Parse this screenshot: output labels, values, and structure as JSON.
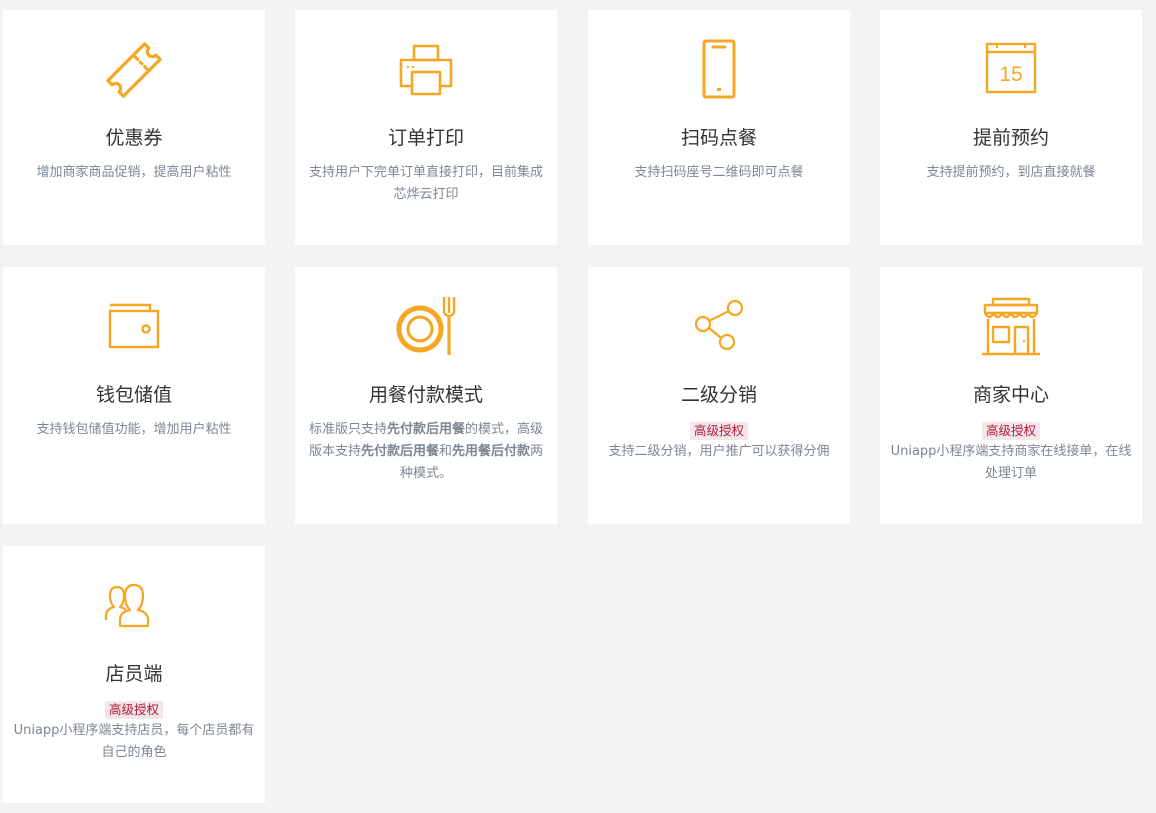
{
  "accent_color": "#f5a623",
  "badge_colors": {
    "background": "#f4e7ea",
    "text": "#b51a3a"
  },
  "cards": [
    {
      "icon": "ticket-icon",
      "title": "优惠券",
      "desc": "增加商家商品促销，提高用户粘性"
    },
    {
      "icon": "printer-icon",
      "title": "订单打印",
      "desc": "支持用户下完单订单直接打印，目前集成芯烨云打印"
    },
    {
      "icon": "phone-icon",
      "title": "扫码点餐",
      "desc": "支持扫码座号二维码即可点餐"
    },
    {
      "icon": "calendar-icon",
      "calendar_day": "15",
      "title": "提前预约",
      "desc": "支持提前预约，到店直接就餐"
    },
    {
      "icon": "wallet-icon",
      "title": "钱包储值",
      "desc": "支持钱包储值功能，增加用户粘性"
    },
    {
      "icon": "dining-icon",
      "title": "用餐付款模式",
      "desc_parts": {
        "p1": "标准版只支持",
        "b1": "先付款后用餐",
        "p2": "的模式，高级版本支持",
        "b2": "先付款后用餐",
        "p3": "和",
        "b3": "先用餐后付款",
        "p4": "两种模式。"
      }
    },
    {
      "icon": "share-icon",
      "title": "二级分销",
      "badge": "高级授权",
      "desc": "支持二级分销，用户推广可以获得分佣"
    },
    {
      "icon": "store-icon",
      "title": "商家中心",
      "badge": "高级授权",
      "desc": "Uniapp小程序端支持商家在线接单，在线处理订单"
    },
    {
      "icon": "users-icon",
      "title": "店员端",
      "badge": "高级授权",
      "desc": "Uniapp小程序端支持店员，每个店员都有自己的角色"
    }
  ]
}
